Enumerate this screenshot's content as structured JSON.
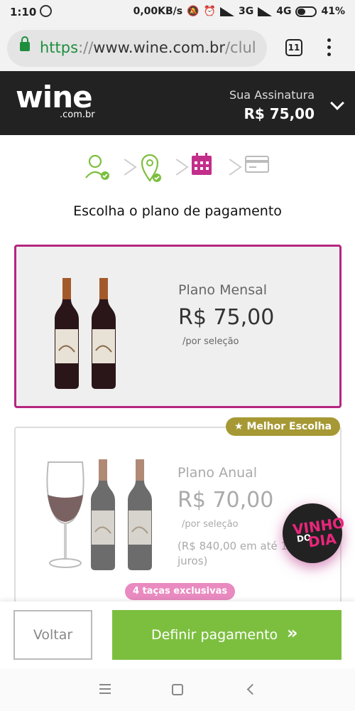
{
  "status_bar": {
    "time": "1:10",
    "speed": "0,00KB/s",
    "network_1": "3G",
    "network_2": "4G",
    "battery": "41%"
  },
  "browser": {
    "url_scheme": "https",
    "url_separator": "://",
    "url_host": "www.wine.com.br",
    "url_path": "/clul",
    "tab_count": "11"
  },
  "header": {
    "logo_text": "wine",
    "logo_sub": ".com.br",
    "subscription_label": "Sua Assinatura",
    "subscription_price": "R$ 75,00"
  },
  "steps": [
    "user-check-icon",
    "location-check-icon",
    "calendar-icon",
    "credit-card-icon"
  ],
  "colors": {
    "accent": "#b5267f",
    "success": "#7cbf3f",
    "header_bg": "#222222",
    "badge_gold": "#a69834",
    "badge_pink": "#e98ac0"
  },
  "page_title": "Escolha o plano de pagamento",
  "plans": [
    {
      "name": "Plano Mensal",
      "price": "R$ 75,00",
      "per": "/por seleção"
    },
    {
      "name": "Plano Anual",
      "price": "R$ 70,00",
      "per": "/por seleção",
      "note_line1": "(R$ 840,00 em até 1",
      "note_line2": "juros)",
      "badge": "Melhor Escolha",
      "badge_star": "★",
      "extra_badge": "4 taças exclusivas"
    }
  ],
  "vinho_do_dia": {
    "line1": "VINHO",
    "line2": "DO",
    "line3": "DIA"
  },
  "actions": {
    "back": "Voltar",
    "next": "Definir pagamento",
    "next_icon": "»"
  }
}
